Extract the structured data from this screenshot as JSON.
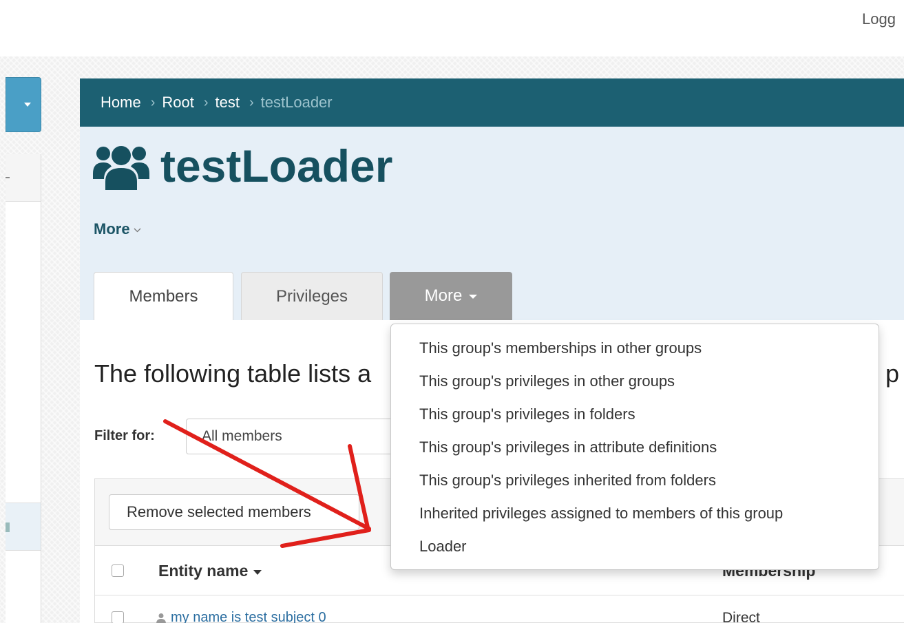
{
  "topbar": {
    "logged_text": "Logg"
  },
  "breadcrumb": {
    "items": [
      "Home",
      "Root",
      "test"
    ],
    "current": "testLoader"
  },
  "header": {
    "title": "testLoader",
    "more_label": "More"
  },
  "tabs": [
    {
      "label": "Members"
    },
    {
      "label": "Privileges"
    },
    {
      "label": "More"
    }
  ],
  "dropdown": {
    "items": [
      "This group's memberships in other groups",
      "This group's privileges in other groups",
      "This group's privileges in folders",
      "This group's privileges in attribute definitions",
      "This group's privileges inherited from folders",
      "Inherited privileges assigned to members of this group",
      "Loader"
    ]
  },
  "content": {
    "lead_text": "The following table lists a",
    "lead_tail": "p",
    "filter_label": "Filter for:",
    "filter_value": "All members",
    "remove_button": "Remove selected members",
    "columns": {
      "entity_name": "Entity name",
      "membership": "Membership"
    },
    "rows": [
      {
        "entity": "my name is test subject 0",
        "membership": "Direct"
      }
    ]
  },
  "annotation": {
    "arrow_color": "#e0201b"
  }
}
